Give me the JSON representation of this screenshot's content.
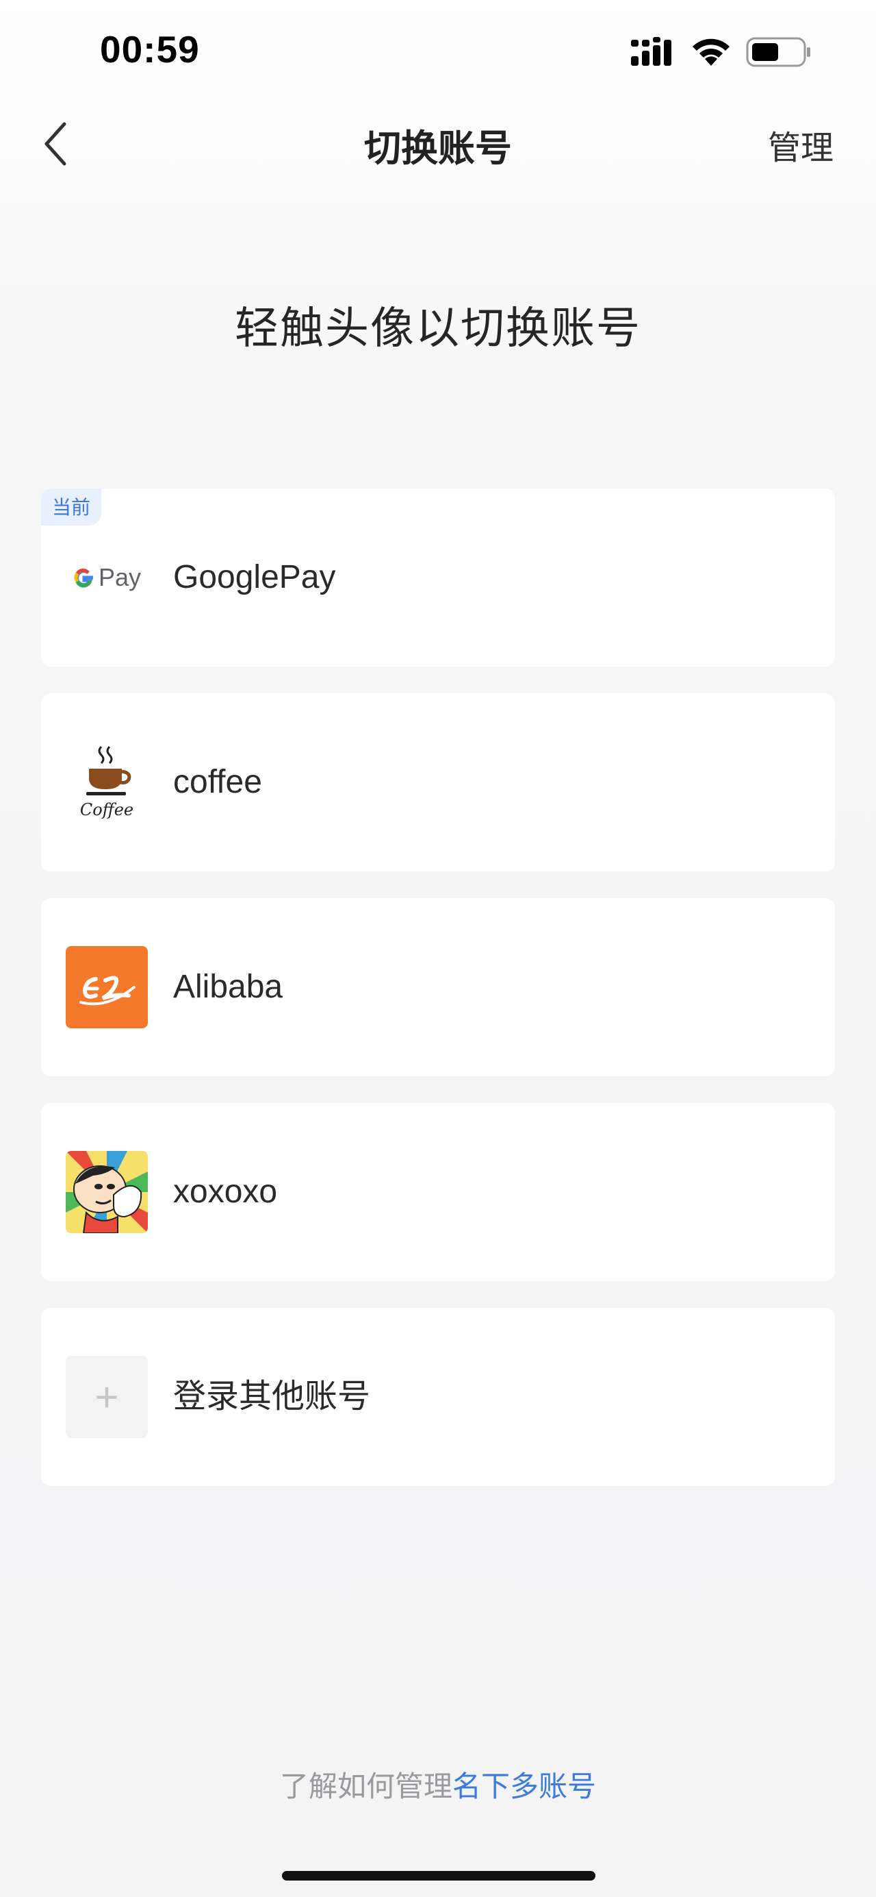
{
  "status_bar": {
    "time": "00:59"
  },
  "nav": {
    "title": "切换账号",
    "manage_label": "管理"
  },
  "hint": "轻触头像以切换账号",
  "accounts": [
    {
      "name": "GooglePay",
      "badge": "当前",
      "avatar_icon": "google-pay-logo-icon",
      "avatar_text": "Pay"
    },
    {
      "name": "coffee",
      "avatar_icon": "coffee-cup-icon",
      "avatar_text": "Coffee"
    },
    {
      "name": "Alibaba",
      "avatar_icon": "alibaba-logo-icon"
    },
    {
      "name": "xoxoxo",
      "avatar_icon": "cartoon-avatar-icon"
    }
  ],
  "add_account": {
    "label": "登录其他账号",
    "icon": "plus-icon",
    "icon_glyph": "+"
  },
  "footer": {
    "prefix": "了解如何管理",
    "link": "名下多账号"
  },
  "colors": {
    "accent": "#3b7ae0",
    "badge_bg": "#e8f0fd",
    "alibaba_orange": "#f5782b"
  }
}
